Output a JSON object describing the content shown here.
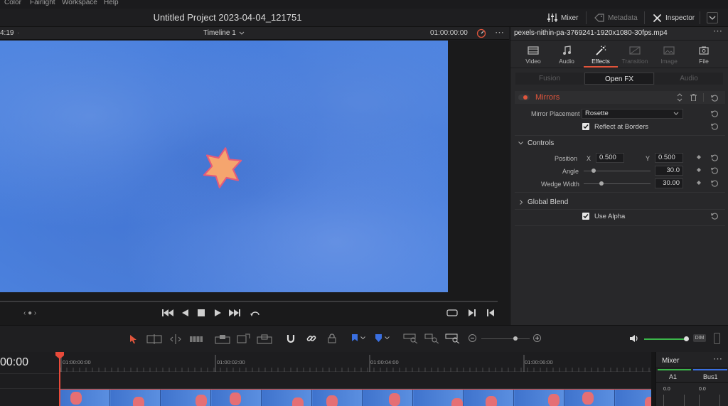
{
  "menu": {
    "items": [
      "Color",
      "Fairlight",
      "Workspace",
      "Help"
    ]
  },
  "titlebar": {
    "project_title": "Untitled Project 2023-04-04_121751",
    "mixer_label": "Mixer",
    "metadata_label": "Metadata",
    "inspector_label": "Inspector"
  },
  "viewer": {
    "left_timecode": "4:19",
    "timeline_name": "Timeline 1",
    "right_timecode": "01:00:00:00"
  },
  "inspector": {
    "clip_name": "pexels-nithin-pa-3769241-1920x1080-30fps.mp4",
    "tabs": [
      {
        "label": "Video",
        "icon": "video-icon",
        "state": "normal"
      },
      {
        "label": "Audio",
        "icon": "music-note-icon",
        "state": "normal"
      },
      {
        "label": "Effects",
        "icon": "magic-wand-icon",
        "state": "active"
      },
      {
        "label": "Transition",
        "icon": "transition-icon",
        "state": "dim"
      },
      {
        "label": "Image",
        "icon": "image-icon",
        "state": "dim"
      },
      {
        "label": "File",
        "icon": "file-icon",
        "state": "normal"
      }
    ],
    "subtabs": [
      "Fusion",
      "Open FX",
      "Audio"
    ],
    "effect_name": "Mirrors",
    "mirror_placement_label": "Mirror Placement",
    "mirror_placement_value": "Rosette",
    "reflect_label": "Reflect at Borders",
    "controls_label": "Controls",
    "position_label": "Position",
    "x_label": "X",
    "x_value": "0.500",
    "y_label": "Y",
    "y_value": "0.500",
    "angle_label": "Angle",
    "angle_value": "30.0",
    "angle_fraction": 0.15,
    "wedge_label": "Wedge Width",
    "wedge_value": "30.00",
    "wedge_fraction": 0.27,
    "global_blend_label": "Global Blend",
    "use_alpha_label": "Use Alpha"
  },
  "timeline": {
    "timecode": "00:00",
    "ruler_labels": [
      "01:00:00:00",
      "01:00:02:00",
      "01:00:04:00",
      "01:00:06:00"
    ]
  },
  "mixer": {
    "title": "Mixer",
    "channels": [
      "A1",
      "Bus1"
    ],
    "levels": [
      "0.0",
      "0.0"
    ]
  },
  "toolbar": {
    "dim_label": "DIM"
  },
  "colors": {
    "accent_red": "#e0553c",
    "video_blue": "#3b72d6",
    "star_fill": "#f5a56e",
    "star_stroke": "#e45b7a",
    "volume_green": "#3bb54a"
  }
}
